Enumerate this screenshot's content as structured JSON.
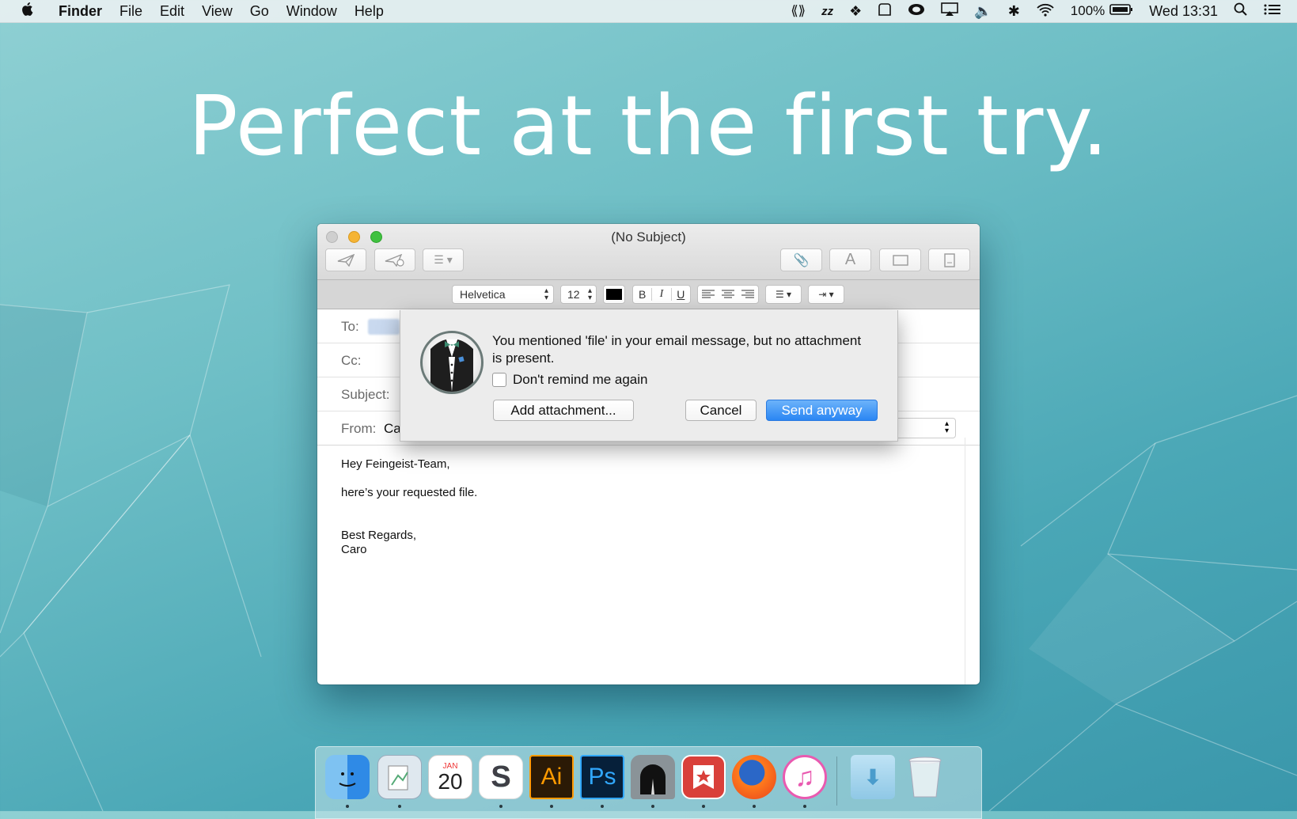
{
  "menubar": {
    "apple": "",
    "app": "Finder",
    "items": [
      "File",
      "Edit",
      "View",
      "Go",
      "Window",
      "Help"
    ],
    "battery": "100%",
    "clock": "Wed 13:31",
    "status_icons": [
      "dropzone-icon",
      "nzb-icon",
      "dropbox-icon",
      "blank-tray-icon",
      "creative-cloud-icon",
      "airplay-icon",
      "volume-icon",
      "bluetooth-icon",
      "wifi-icon",
      "battery-icon",
      "spotlight-icon",
      "notification-center-icon"
    ]
  },
  "headline": "Perfect at the first try.",
  "mail_window": {
    "title": "(No Subject)",
    "font_name": "Helvetica",
    "font_size": "12",
    "bold": "B",
    "italic": "I",
    "underline": "U",
    "to_label": "To:",
    "cc_label": "Cc:",
    "subject_label": "Subject:",
    "from_label": "From:",
    "from_value": "Ca",
    "body_lines": [
      "Hey Feingeist-Team,",
      "here’s your requested file.",
      "Best Regards,",
      "Caro"
    ]
  },
  "alert": {
    "message": "You mentioned 'file' in your email message, but no attachment is present.",
    "checkbox_label": "Don't remind me again",
    "checkbox_checked": false,
    "add_attachment": "Add attachment...",
    "cancel": "Cancel",
    "send_anyway": "Send anyway"
  },
  "dock": {
    "apps": [
      "finder-icon",
      "preview-icon",
      "calendar-icon",
      "slack-icon",
      "illustrator-icon",
      "photoshop-icon",
      "tunnel-icon",
      "wunderlist-icon",
      "firefox-icon",
      "itunes-icon",
      "downloads-icon",
      "trash-icon"
    ],
    "calendar_month": "JAN",
    "calendar_day": "20",
    "illustrator_label": "Ai",
    "photoshop_label": "Ps",
    "slack_label": "S"
  },
  "colors": {
    "accent": "#2a86f3",
    "close": "#d0d0d0",
    "minimize": "#f5b434",
    "zoom": "#3fc13f"
  }
}
